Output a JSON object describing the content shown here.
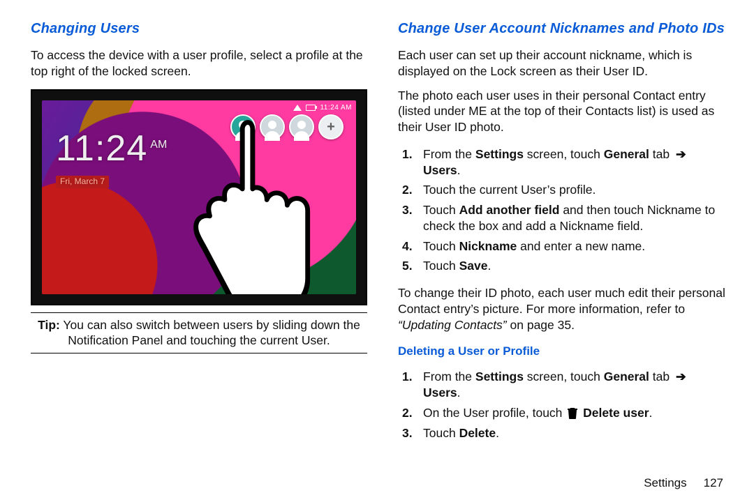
{
  "left": {
    "title": "Changing Users",
    "intro": "To access the device with a user profile, select a profile at the top right of the locked screen.",
    "figure": {
      "time": "11:24",
      "ampm": "AM",
      "date": "Fri, March 7",
      "status_time": "11:24 AM"
    },
    "tip_label": "Tip:",
    "tip_text": " You can also switch between users by sliding down the Notification Panel and touching the current User."
  },
  "right": {
    "title": "Change User Account Nicknames and Photo IDs",
    "p1": "Each user can set up their account nickname, which is displayed on the Lock screen as their User ID.",
    "p2": "The photo each user uses in their personal Contact entry (listed under ME at the top of their Contacts list) is used as their User ID photo.",
    "steps_a": {
      "s1_a": "From the ",
      "s1_settings": "Settings",
      "s1_b": " screen, touch ",
      "s1_general": "General",
      "s1_c": " tab ",
      "s1_users": "Users",
      "s1_d": ".",
      "s2": "Touch the current User’s profile.",
      "s3_a": "Touch ",
      "s3_addfield": "Add another field",
      "s3_b": " and then touch Nickname to check the box and add a Nickname field.",
      "s4_a": "Touch ",
      "s4_nick": "Nickname",
      "s4_b": " and enter a new name.",
      "s5_a": "Touch ",
      "s5_save": "Save",
      "s5_b": "."
    },
    "p3_a": "To change their ID photo, each user much edit their personal Contact entry’s picture. For more information, refer to ",
    "p3_link": "“Updating Contacts”",
    "p3_b": " on page 35.",
    "sub_title": "Deleting a User or Profile",
    "steps_b": {
      "s1_a": "From the ",
      "s1_settings": "Settings",
      "s1_b": " screen, touch ",
      "s1_general": "General",
      "s1_c": " tab ",
      "s1_users": "Users",
      "s1_d": ".",
      "s2_a": "On the User profile, touch ",
      "s2_delete_user": "Delete user",
      "s2_b": ".",
      "s3_a": "Touch ",
      "s3_delete": "Delete",
      "s3_b": "."
    }
  },
  "footer": {
    "section": "Settings",
    "page": "127"
  },
  "arrow_glyph": "➔"
}
